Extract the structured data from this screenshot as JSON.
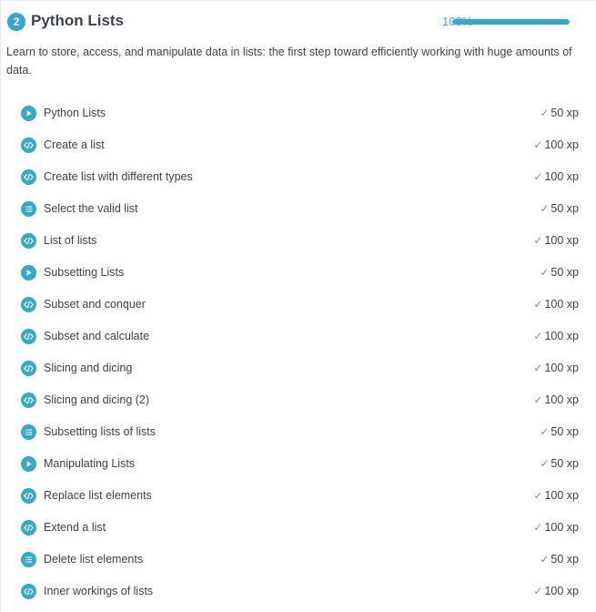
{
  "chapter": {
    "number": "2",
    "title": "Python Lists",
    "progress_label": "100%",
    "progress_fraction": 1.0,
    "description": "Learn to store, access, and manipulate data in lists: the first step toward efficiently working with huge amounts of data.",
    "accent_color": "#33aacc"
  },
  "exercises": [
    {
      "title": "Python Lists",
      "xp": "50 xp",
      "type": "video",
      "icon": "play-icon"
    },
    {
      "title": "Create a list",
      "xp": "100 xp",
      "type": "code",
      "icon": "code-icon"
    },
    {
      "title": "Create list with different types",
      "xp": "100 xp",
      "type": "code",
      "icon": "code-icon"
    },
    {
      "title": "Select the valid list",
      "xp": "50 xp",
      "type": "multiple-choice",
      "icon": "list-icon"
    },
    {
      "title": "List of lists",
      "xp": "100 xp",
      "type": "code",
      "icon": "code-icon"
    },
    {
      "title": "Subsetting Lists",
      "xp": "50 xp",
      "type": "video",
      "icon": "play-icon"
    },
    {
      "title": "Subset and conquer",
      "xp": "100 xp",
      "type": "code",
      "icon": "code-icon"
    },
    {
      "title": "Subset and calculate",
      "xp": "100 xp",
      "type": "code",
      "icon": "code-icon"
    },
    {
      "title": "Slicing and dicing",
      "xp": "100 xp",
      "type": "code",
      "icon": "code-icon"
    },
    {
      "title": "Slicing and dicing (2)",
      "xp": "100 xp",
      "type": "code",
      "icon": "code-icon"
    },
    {
      "title": "Subsetting lists of lists",
      "xp": "50 xp",
      "type": "multiple-choice",
      "icon": "list-icon"
    },
    {
      "title": "Manipulating Lists",
      "xp": "50 xp",
      "type": "video",
      "icon": "play-icon"
    },
    {
      "title": "Replace list elements",
      "xp": "100 xp",
      "type": "code",
      "icon": "code-icon"
    },
    {
      "title": "Extend a list",
      "xp": "100 xp",
      "type": "code",
      "icon": "code-icon"
    },
    {
      "title": "Delete list elements",
      "xp": "50 xp",
      "type": "multiple-choice",
      "icon": "list-icon"
    },
    {
      "title": "Inner workings of lists",
      "xp": "100 xp",
      "type": "code",
      "icon": "code-icon"
    }
  ],
  "check_glyph": "✓"
}
